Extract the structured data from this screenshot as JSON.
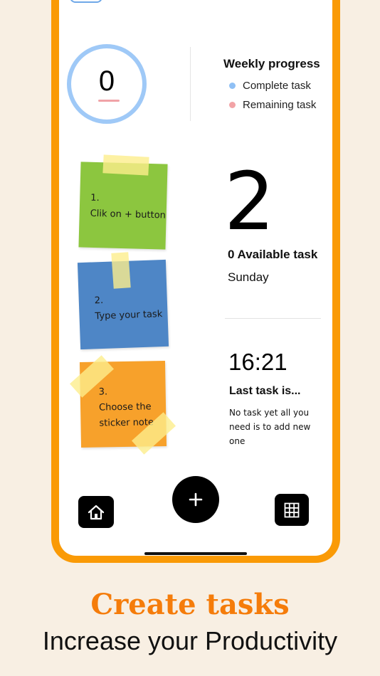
{
  "colors": {
    "frame": "#fa9a06",
    "headline": "#f57c0a",
    "ring": "#9fc9f7",
    "complete_dot": "#8fc0f5",
    "remaining_dot": "#f2a3a6",
    "note_green": "#8cc63f",
    "note_blue": "#4e86c6",
    "note_orange": "#f7a12b"
  },
  "progress": {
    "value": "0",
    "title": "Weekly progress",
    "legend": [
      {
        "label": "Complete task",
        "color": "#8fc0f5"
      },
      {
        "label": "Remaining task",
        "color": "#f2a3a6"
      }
    ]
  },
  "notes": [
    {
      "number": "1.",
      "text": "Clik on + button",
      "color": "#8cc63f"
    },
    {
      "number": "2.",
      "text": "Type your task",
      "color": "#4e86c6"
    },
    {
      "number": "3.",
      "text": "Choose the\nsticker note",
      "color": "#f7a12b"
    }
  ],
  "summary": {
    "big_number": "2",
    "available": "0 Available task",
    "weekday": "Sunday",
    "time": "16:21",
    "last_task_title": "Last task is...",
    "last_task_desc": "No task yet all you need is to add new one"
  },
  "nav": {
    "home_icon": "home-icon",
    "add_icon": "plus-icon",
    "grid_icon": "grid-icon"
  },
  "caption": {
    "headline": "Create tasks",
    "subline": "Increase your Productivity"
  }
}
